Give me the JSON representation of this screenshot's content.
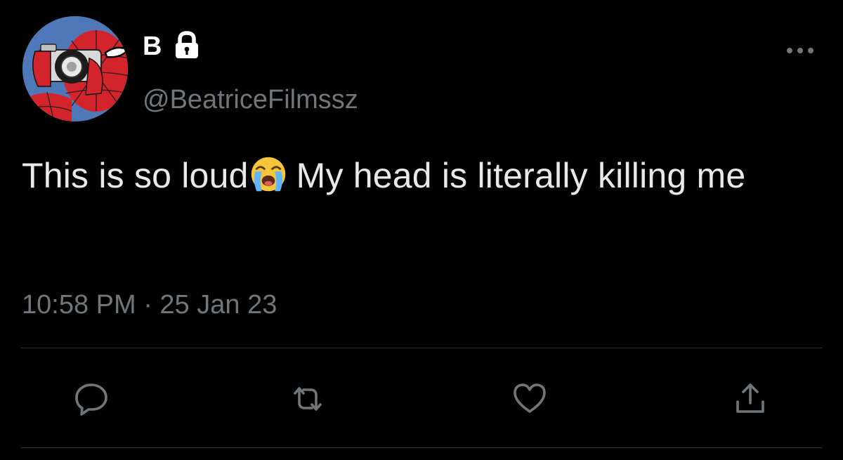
{
  "tweet": {
    "display_name": "B",
    "handle": "@BeatriceFilmssz",
    "text_before_emoji": "This is so loud",
    "emoji": "loudly-crying-face-emoji",
    "text_after_emoji": "My head is literally killing me",
    "timestamp": "10:58 PM · 25 Jan 23"
  },
  "icons": {
    "lock": "lock-icon",
    "more": "more-horizontal-icon",
    "reply": "reply-icon",
    "retweet": "retweet-icon",
    "like": "heart-icon",
    "share": "share-icon"
  },
  "colors": {
    "background": "#000000",
    "primary_text": "#e7e9ea",
    "secondary_text": "#71767b",
    "divider": "#2f3336",
    "avatar_red": "#d3232b",
    "avatar_blue": "#4f78b8"
  }
}
